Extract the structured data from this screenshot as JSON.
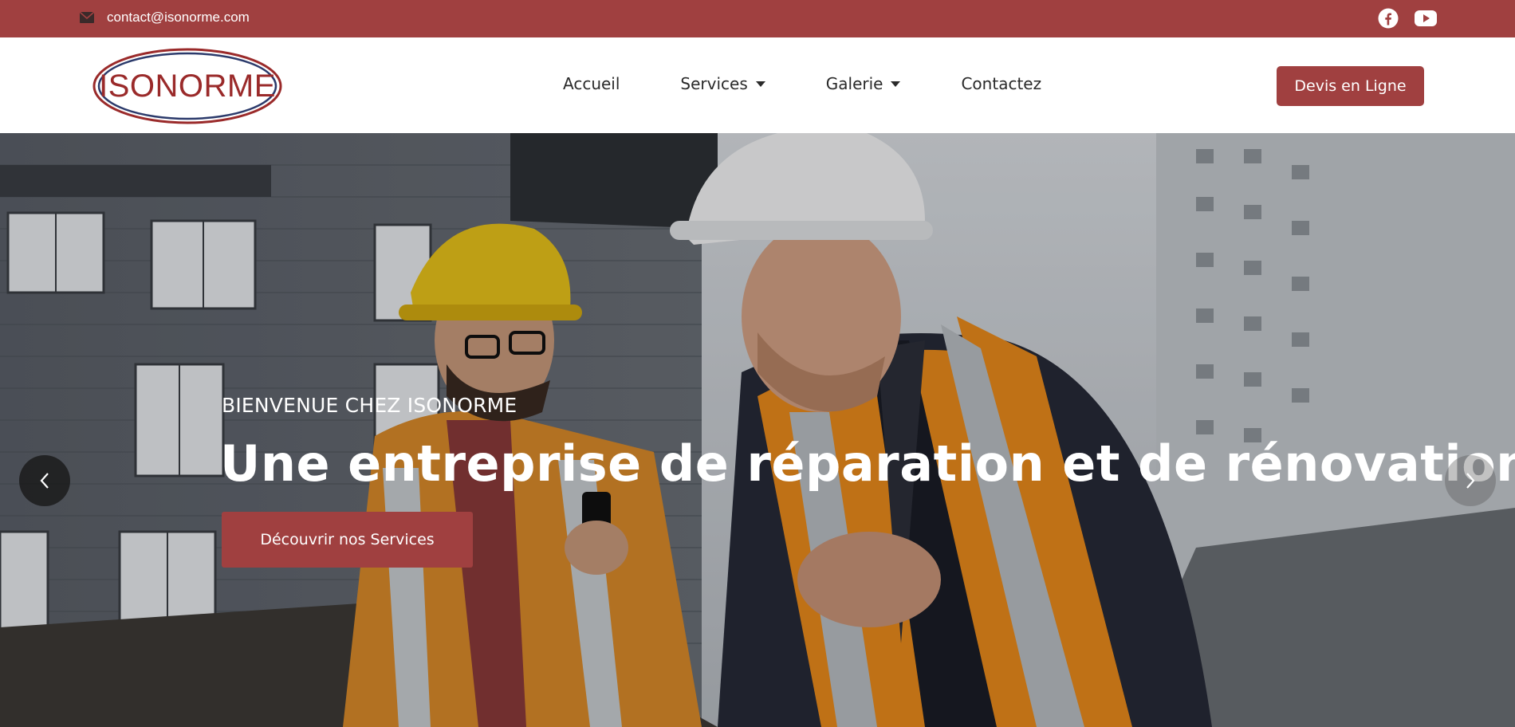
{
  "topbar": {
    "email": "contact@isonorme.com",
    "mail_icon": "envelope-icon",
    "social": [
      "facebook-icon",
      "youtube-icon"
    ]
  },
  "navbar": {
    "logo_text": "ISONORME",
    "menu": {
      "accueil": "Accueil",
      "services": "Services",
      "galerie": "Galerie",
      "contactez": "Contactez"
    },
    "devis_label": "Devis en Ligne"
  },
  "hero": {
    "subtitle": "BIENVENUE CHEZ ISONORME",
    "title": "Une entreprise de réparation et de rénovation",
    "cta_label": "Découvrir nos Services",
    "prev_icon": "chevron-left-icon",
    "next_icon": "chevron-right-icon"
  },
  "colors": {
    "brand": "#a04040",
    "logo_red": "#9a2a2a",
    "logo_navy": "#2b3a6b"
  }
}
